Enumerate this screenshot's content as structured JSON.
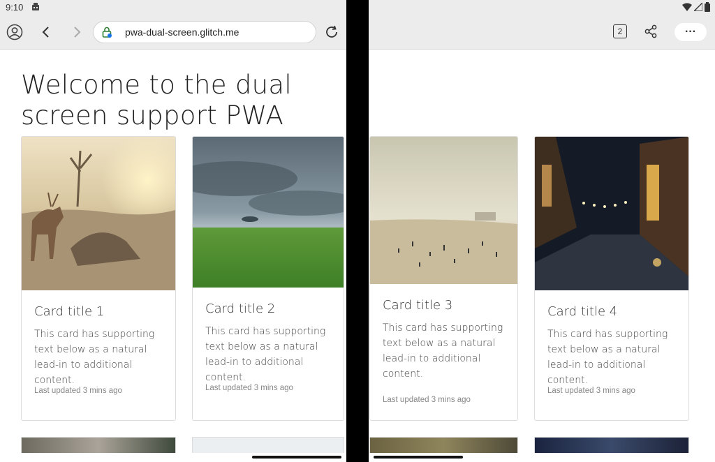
{
  "status_bar": {
    "time": "9:10"
  },
  "browser": {
    "url": "pwa-dual-screen.glitch.me",
    "tab_count": "2",
    "more_label": "···"
  },
  "page": {
    "title": "Welcome to the dual screen support PWA",
    "cards": [
      {
        "title": "Card title 1",
        "text": "This card has supporting text below as a natural lead-in to additional content.",
        "footer": "Last updated 3 mins ago",
        "image": "deer-in-field"
      },
      {
        "title": "Card title 2",
        "text": "This card has supporting text below as a natural lead-in to additional content.",
        "footer": "Last updated 3 mins ago",
        "image": "storm-over-grassland"
      },
      {
        "title": "Card title 3",
        "text": "This card has supporting text below as a natural lead-in to additional content.",
        "footer": "Last updated 3 mins ago",
        "image": "crowded-beach"
      },
      {
        "title": "Card title 4",
        "text": "This card has supporting text below as a natural lead-in to additional content.",
        "footer": "Last updated 3 mins ago",
        "image": "night-street"
      }
    ]
  },
  "icons": {
    "profile": "profile-icon",
    "back": "back-icon",
    "forward": "forward-icon",
    "lock": "lock-icon",
    "reload": "reload-icon",
    "tabs": "tabs-icon",
    "share": "share-icon",
    "more": "more-icon",
    "wifi": "wifi-icon",
    "signal": "signal-icon",
    "battery": "battery-icon",
    "notification": "notification-icon"
  }
}
